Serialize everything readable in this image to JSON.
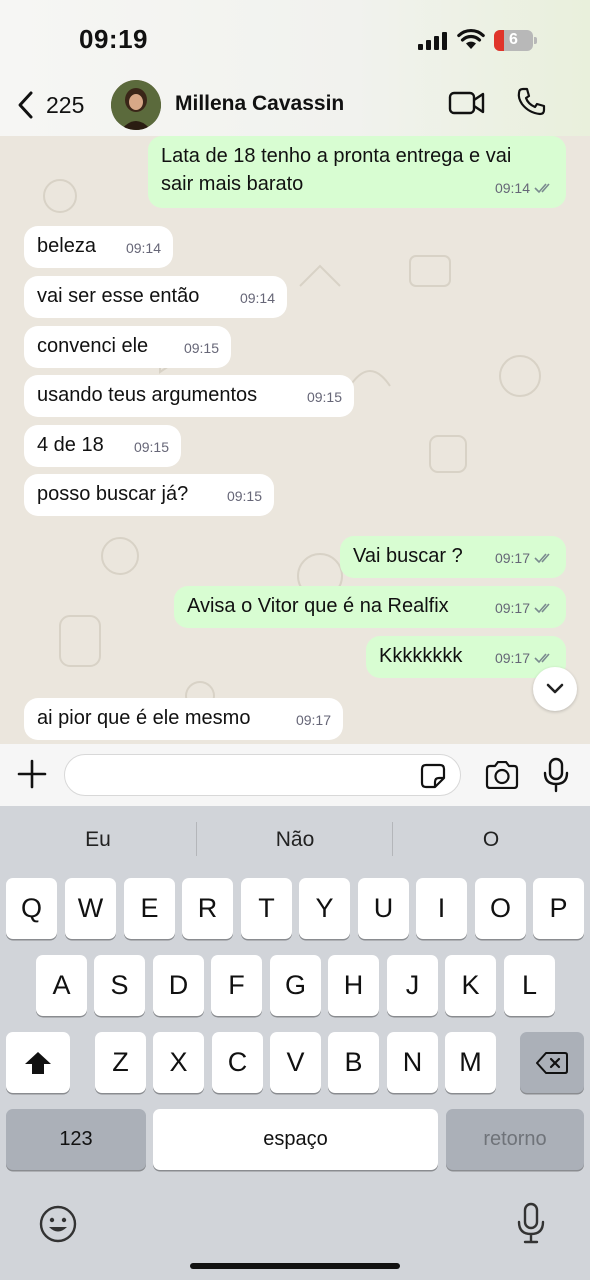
{
  "status_bar": {
    "time": "09:19",
    "battery_level": "6"
  },
  "header": {
    "back_count": "225",
    "contact_name": "Millena Cavassin"
  },
  "messages": [
    {
      "dir": "out",
      "text": "Lata de 18 tenho a pronta entrega e vai\nsair mais barato",
      "time": "09:14"
    },
    {
      "dir": "in",
      "text": "beleza",
      "time": "09:14"
    },
    {
      "dir": "in",
      "text": "vai ser esse então",
      "time": "09:14"
    },
    {
      "dir": "in",
      "text": "convenci ele",
      "time": "09:15"
    },
    {
      "dir": "in",
      "text": "usando teus argumentos",
      "time": "09:15"
    },
    {
      "dir": "in",
      "text": "4 de 18",
      "time": "09:15"
    },
    {
      "dir": "in",
      "text": "posso buscar já?",
      "time": "09:15"
    },
    {
      "dir": "out",
      "text": "Vai buscar ?",
      "time": "09:17"
    },
    {
      "dir": "out",
      "text": "Avisa o Vitor que é na Realfix",
      "time": "09:17"
    },
    {
      "dir": "out",
      "text": "Kkkkkkkk",
      "time": "09:17"
    },
    {
      "dir": "in",
      "text": "ai pior que é ele mesmo",
      "time": "09:17"
    }
  ],
  "keyboard": {
    "suggestions": [
      "Eu",
      "Não",
      "O"
    ],
    "row1": [
      "Q",
      "W",
      "E",
      "R",
      "T",
      "Y",
      "U",
      "I",
      "O",
      "P"
    ],
    "row2": [
      "A",
      "S",
      "D",
      "F",
      "G",
      "H",
      "J",
      "K",
      "L"
    ],
    "row3": [
      "Z",
      "X",
      "C",
      "V",
      "B",
      "N",
      "M"
    ],
    "numbers_label": "123",
    "space_label": "espaço",
    "return_label": "retorno"
  },
  "colors": {
    "outgoing_bubble": "#d8fdd2",
    "incoming_bubble": "#ffffff",
    "chat_bg": "#ebe6dd",
    "keyboard_bg": "#d1d4d9"
  }
}
